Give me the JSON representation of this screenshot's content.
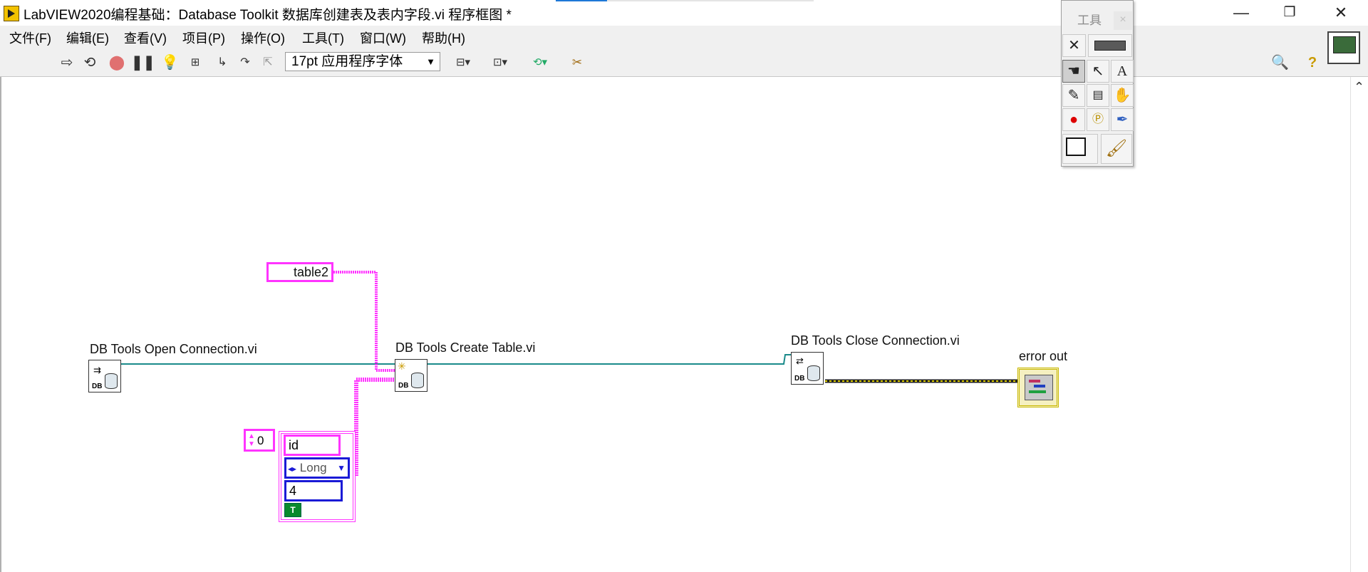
{
  "window": {
    "title": "LabVIEW2020编程基础：Database Toolkit 数据库创建表及表内字段.vi 程序框图 *",
    "minimize_glyph": "—",
    "restore_glyph": "❐",
    "close_glyph": "✕"
  },
  "menu": [
    {
      "label": "文件(F)"
    },
    {
      "label": "编辑(E)"
    },
    {
      "label": "查看(V)"
    },
    {
      "label": "项目(P)"
    },
    {
      "label": "操作(O)"
    },
    {
      "label": "工具(T)"
    },
    {
      "label": "窗口(W)"
    },
    {
      "label": "帮助(H)"
    }
  ],
  "toolbar": {
    "font_selector_value": "17pt 应用程序字体",
    "icons": [
      "run-arrow-icon",
      "run-continuously-icon",
      "abort-icon",
      "pause-icon",
      "highlight-execution-icon",
      "retain-wire-values-icon",
      "step-into-icon",
      "step-over-icon",
      "step-out-icon",
      "align-objects-icon",
      "distribute-objects-icon",
      "reorder-icon",
      "clean-up-diagram-icon",
      "search-icon",
      "context-help-icon"
    ]
  },
  "diagram": {
    "constant_table_name": "table2",
    "open_connection_label": "DB Tools Open Connection.vi",
    "create_table_label": "DB Tools Create Table.vi",
    "close_connection_label": "DB Tools Close Connection.vi",
    "error_out_label": "error out",
    "vi_db_text": "DB",
    "array": {
      "index_value": "0",
      "field_name": "id",
      "field_type": "Long",
      "field_size": "4",
      "bool_text": "T"
    },
    "colors": {
      "string_wire": "#ff34ff",
      "refnum_wire": "#1a8a8a",
      "error_wire": "#c7b700"
    }
  },
  "tools_palette": {
    "title": "工具",
    "close_glyph": "×",
    "tools": [
      "automatic-tool-icon",
      "operate-value-icon",
      "position-select-icon",
      "edit-text-icon",
      "connect-wire-icon",
      "object-shortcut-menu-icon",
      "scroll-window-icon",
      "set-breakpoint-icon",
      "probe-data-icon",
      "get-color-icon",
      "set-color-icon"
    ]
  }
}
